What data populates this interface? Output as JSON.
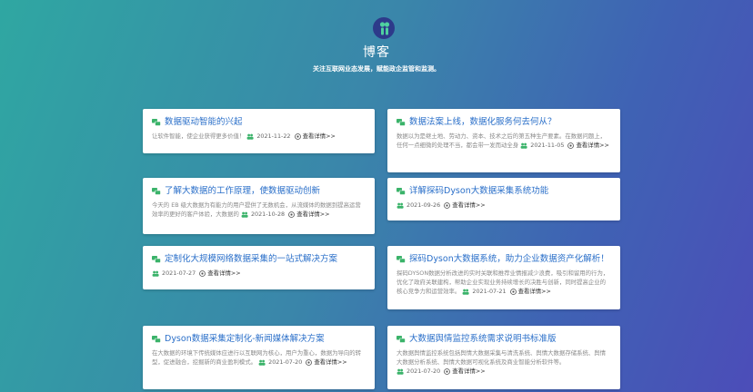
{
  "header": {
    "blog_title": "博客",
    "slogan": "关注互联网业态发展，赋能政企监管和监测。"
  },
  "colors": {
    "title_blue": "#2a6fc9",
    "icon_green": "#3bb36a"
  },
  "posts": [
    {
      "title": "数据驱动智能的兴起",
      "summary": "让软件智能，使企业获得更多价值！",
      "date": "2021-11-22",
      "more": "查看详情>>"
    },
    {
      "title": "数据法案上线，数据化服务何去何从？",
      "summary": "数据以为是继土地、劳动力、资本、技术之后的第五种生产要素。在数据问题上，任何一点细微的处理不当，都会带一发而动全身",
      "date": "2021-11-05",
      "more": "查看详情>>"
    },
    {
      "title": "了解大数据的工作原理，使数据驱动创新",
      "summary": "今天的 EB 级大数据为有能力的用户提供了无数机会，从流媒体的数据到提高运营效率的更好的客户体验，大数据的",
      "date": "2021-10-28",
      "more": "查看详情>>"
    },
    {
      "title": "详解探码Dyson大数据采集系统功能",
      "summary": "",
      "date": "2021-09-26",
      "more": "查看详情>>"
    },
    {
      "title": "定制化大规模网络数据采集的一站式解决方案",
      "summary": "",
      "date": "2021-07-27",
      "more": "查看详情>>"
    },
    {
      "title": "探码Dyson大数据系统，助力企业数据资产化解析！",
      "summary": "探码DYSON数据分析改进的实时关联和推荐业情报减少浪费，吸引和留用的行为，优化了政府关联建构，帮助企业实现业务持续增长的决胜与创新，同时提高企业的核心竞争力和运营效率。",
      "date": "2021-07-21",
      "more": "查看详情>>"
    },
    {
      "title": "Dyson数据采集定制化-新闻媒体解决方案",
      "summary": "在大数据的环境下传统媒体应进行以互联网为核心，用户为重心，数据为导向的转型，促进融合，挖掘新的商业盈利模式。",
      "date": "2021-07-20",
      "more": "查看详情>>"
    },
    {
      "title": "大数据舆情监控系统需求说明书标准版",
      "summary": "大数据舆情监控系统包括舆情大数据采集与清洗系统、舆情大数据存储系统、舆情大数据分析系统、舆情大数据可视化系统及商业智能分析软件等。",
      "date": "2021-07-20",
      "more": "查看详情>>"
    }
  ]
}
